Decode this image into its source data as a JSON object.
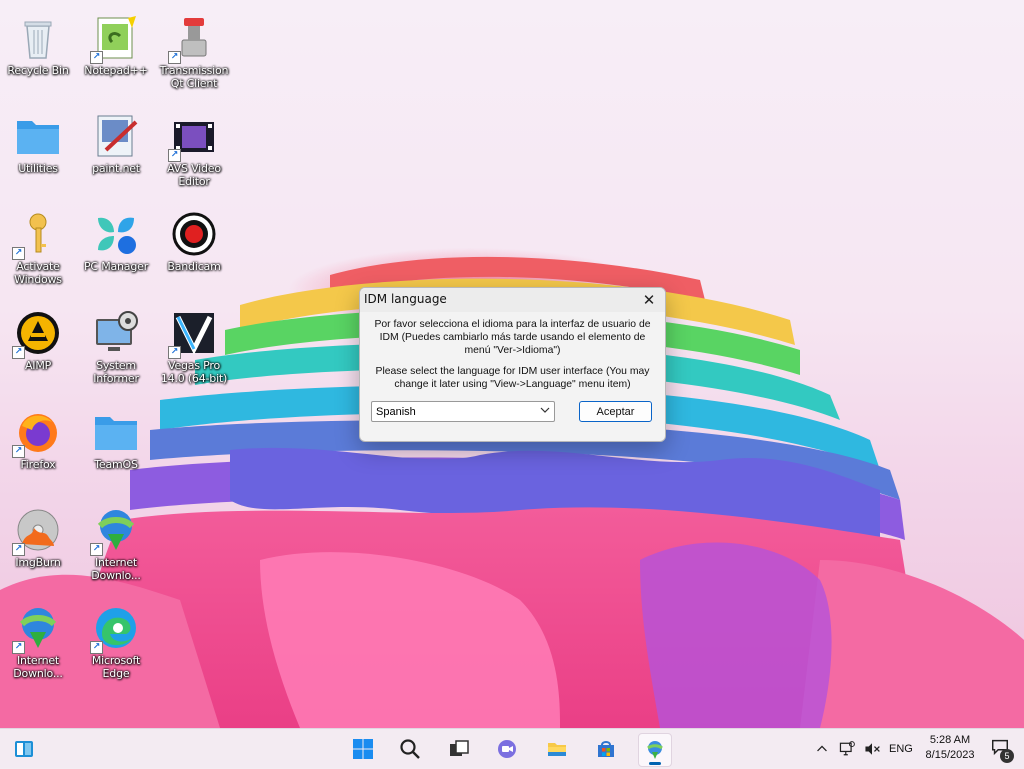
{
  "desktop": {
    "icons": [
      {
        "label": "Recycle Bin",
        "icon": "recycle-bin-icon",
        "shortcut": false
      },
      {
        "label": "Notepad++",
        "icon": "notepad-plus-plus-icon",
        "shortcut": true
      },
      {
        "label": "Transmission Qt Client",
        "icon": "transmission-icon",
        "shortcut": true
      },
      {
        "label": "Utilities",
        "icon": "folder-icon",
        "shortcut": false
      },
      {
        "label": "paint.net",
        "icon": "paint-net-icon",
        "shortcut": false
      },
      {
        "label": "AVS Video Editor",
        "icon": "avs-video-editor-icon",
        "shortcut": true
      },
      {
        "label": "Activate Windows",
        "icon": "key-icon",
        "shortcut": true
      },
      {
        "label": "PC Manager",
        "icon": "pc-manager-icon",
        "shortcut": false
      },
      {
        "label": "Bandicam",
        "icon": "bandicam-icon",
        "shortcut": false
      },
      {
        "label": "AIMP",
        "icon": "aimp-icon",
        "shortcut": true
      },
      {
        "label": "System Informer",
        "icon": "system-informer-icon",
        "shortcut": false
      },
      {
        "label": "Vegas Pro 14.0 (64-bit)",
        "icon": "vegas-pro-icon",
        "shortcut": true
      },
      {
        "label": "Firefox",
        "icon": "firefox-icon",
        "shortcut": true
      },
      {
        "label": "TeamOS",
        "icon": "folder-icon",
        "shortcut": false
      },
      {
        "label": "ImgBurn",
        "icon": "imgburn-icon",
        "shortcut": true
      },
      {
        "label": "Internet Downlo...",
        "icon": "idm-icon",
        "shortcut": true
      },
      {
        "label": "Internet Downlo...",
        "icon": "idm-icon",
        "shortcut": true
      },
      {
        "label": "Microsoft Edge",
        "icon": "edge-icon",
        "shortcut": true
      }
    ]
  },
  "dialog": {
    "title": "IDM language",
    "message_es": "Por favor selecciona el idioma para la interfaz de usuario de IDM (Puedes cambiarlo más tarde usando el elemento de menú \"Ver->Idioma\")",
    "message_en": "Please select the language for IDM user interface (You may change it later using \"View->Language\" menu item)",
    "language_value": "Spanish",
    "accept_label": "Aceptar",
    "close_glyph": "✕"
  },
  "taskbar": {
    "language": "ENG",
    "time": "5:28 AM",
    "date": "8/15/2023",
    "notification_count": "5",
    "items": [
      "start",
      "search",
      "task-view",
      "teams",
      "file-explorer",
      "microsoft-store",
      "internet-download-manager"
    ],
    "active_item": "internet-download-manager"
  },
  "colors": {
    "accent": "#0063b1",
    "button_border": "#0a64c8"
  }
}
